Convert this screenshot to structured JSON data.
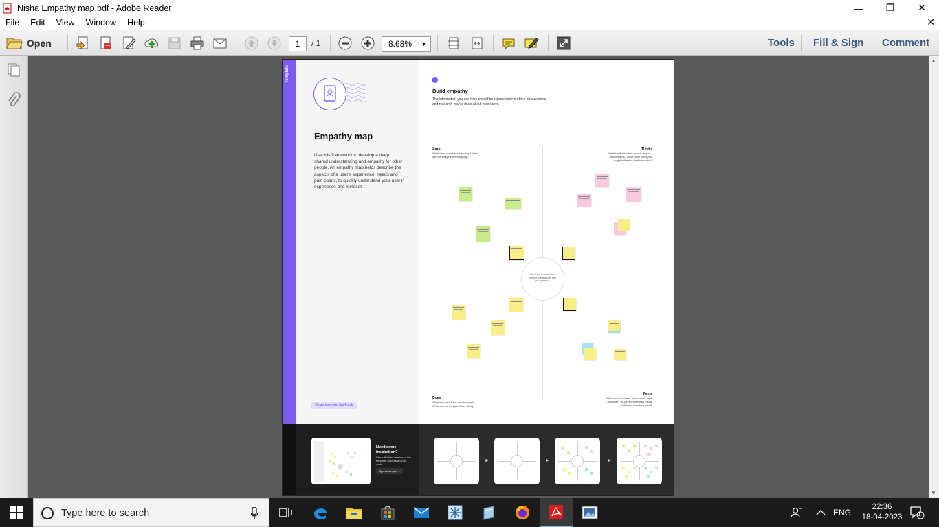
{
  "window": {
    "title": "Nisha Empathy map.pdf - Adobe Reader",
    "controls": {
      "minimize": "—",
      "maximize": "❐",
      "close": "✕"
    }
  },
  "menubar": {
    "items": [
      "File",
      "Edit",
      "View",
      "Window",
      "Help"
    ],
    "doc_close": "✕"
  },
  "toolbar": {
    "open_label": "Open",
    "page_current": "1",
    "page_total": "/ 1",
    "zoom": "8.68%",
    "tools_label": "Tools",
    "fill_sign_label": "Fill & Sign",
    "comment_label": "Comment"
  },
  "document": {
    "left_panel": {
      "stripe_label": "Template",
      "title": "Empathy map",
      "description": "Use this framework to develop a deep, shared understanding and empathy for other people. An empathy map helps describe the aspects of a user's experience, needs and pain points, to quickly understand your users' experience and mindset.",
      "feedback": "Share template feedback"
    },
    "right_panel": {
      "heading": "Build empathy",
      "description": "The information you add here should be representative of the observations and research you've done about your users.",
      "says_title": "Says",
      "says_desc": "What have we heard them say? What can we imagine them saying?",
      "thinks_title": "Thinks",
      "thinks_desc": "What are their wants, needs, hopes, and dreams? What other thoughts might influence their behavior?",
      "does_title": "Does",
      "does_desc": "What behavior have we observed? What can we imagine them doing?",
      "feels_title": "Feels",
      "feels_desc": "What are their fears, frustrations, and anxieties? What other feelings might influence their behavior?",
      "center": "Give them a name and a portrait to empathize with your persona."
    },
    "inspiration": {
      "title": "Need some inspiration?",
      "description": "See a finished version of this template to kickstart your work.",
      "button": "Open example"
    }
  },
  "taskbar": {
    "search_placeholder": "Type here to search",
    "language": "ENG",
    "time": "22:36",
    "date": "18-04-2023",
    "notification_count": "1"
  },
  "colors": {
    "accent_purple": "#7b5cf0",
    "toolbar_blue": "#3a5a80",
    "sticky_yellow": "#f7ef86",
    "sticky_pink": "#f9c9e0",
    "sticky_green": "#c9ec8a",
    "sticky_blue": "#a8e3f5"
  }
}
